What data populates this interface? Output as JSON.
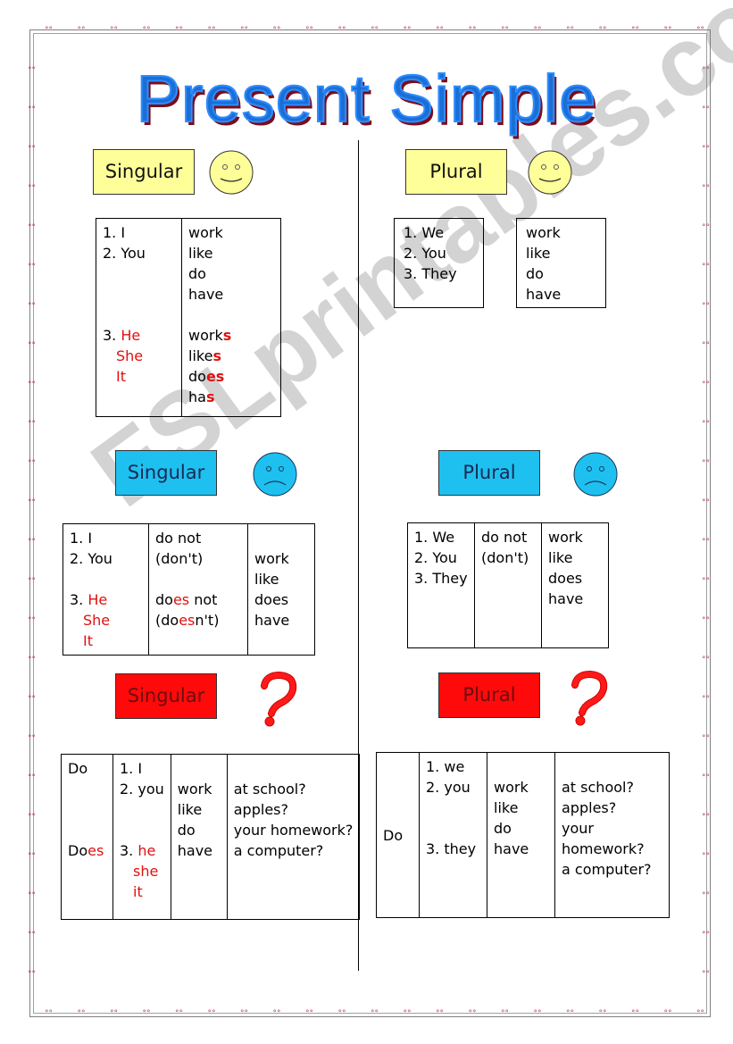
{
  "title": "Present Simple",
  "watermark": "ESLprintables.com",
  "colors": {
    "affirmative": "#ffff99",
    "negative": "#1ec0f0",
    "question": "#ff0a0a",
    "highlight": "#e01010",
    "title": "#1a6fd6"
  },
  "affirmative": {
    "singular": {
      "label": "Singular",
      "icon": "smiley-face-icon",
      "pronouns_a": [
        "1. I",
        "2. You"
      ],
      "verbs_a": [
        "work",
        "like",
        "do",
        "have"
      ],
      "pronoun_3_prefix": "3. ",
      "pronouns_3": [
        "He",
        "She",
        "It"
      ],
      "verbs_3": [
        {
          "stem": "work",
          "ending": "s"
        },
        {
          "stem": "like",
          "ending": "s"
        },
        {
          "stem": "do",
          "ending": "es"
        },
        {
          "stem": "ha",
          "ending": "s"
        }
      ]
    },
    "plural": {
      "label": "Plural",
      "icon": "smiley-face-icon",
      "pronouns": [
        "1. We",
        "2. You",
        "3. They"
      ],
      "verbs": [
        "work",
        "like",
        "do",
        "have"
      ]
    }
  },
  "negative": {
    "singular": {
      "label": "Singular",
      "icon": "sad-face-icon",
      "pronouns_a": [
        "1. I",
        "2. You"
      ],
      "aux_a": [
        "do not",
        "(don't)"
      ],
      "pronoun_3_prefix": "3. ",
      "pronouns_3": [
        "He",
        "She",
        "It"
      ],
      "aux_3": {
        "line1": {
          "pre": "do",
          "hl": "es",
          "post": " not"
        },
        "line2": {
          "pre": "(do",
          "hl": "es",
          "post": "n't)"
        }
      },
      "verbs": [
        "work",
        "like",
        "does",
        "have"
      ]
    },
    "plural": {
      "label": "Plural",
      "icon": "sad-face-icon",
      "pronouns": [
        "1. We",
        "2. You",
        "3. They"
      ],
      "aux": [
        "do not",
        "(don't)"
      ],
      "verbs": [
        "work",
        "like",
        "does",
        "have"
      ]
    }
  },
  "question": {
    "singular": {
      "label": "Singular",
      "icon": "question-mark-icon",
      "aux_do": "Do",
      "aux_does": {
        "pre": "Do",
        "hl": "es"
      },
      "pronouns_a": [
        "1. I",
        "2. you"
      ],
      "pronoun_3_prefix": "3. ",
      "pronouns_3": [
        "he",
        "she",
        "it"
      ],
      "verbs": [
        "work",
        "like",
        "do",
        "have"
      ],
      "objects": [
        "at school?",
        "apples?",
        "your homework?",
        "a computer?"
      ]
    },
    "plural": {
      "label": "Plural",
      "icon": "question-mark-icon",
      "aux": "Do",
      "pronouns_a": [
        "1. we",
        "2. you"
      ],
      "pronoun_3": "3. they",
      "verbs": [
        "work",
        "like",
        "do",
        "have"
      ],
      "objects": [
        "at school?",
        "apples?",
        "your",
        "homework?",
        "a computer?"
      ]
    }
  }
}
